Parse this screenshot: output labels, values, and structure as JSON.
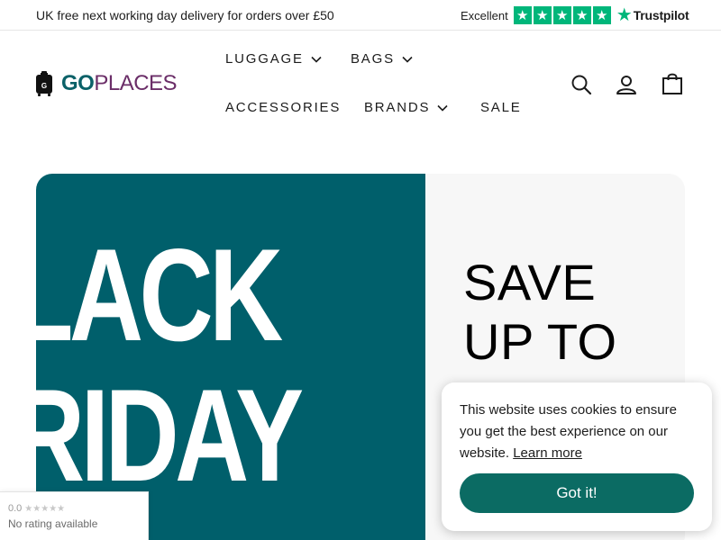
{
  "topbar": {
    "promo": "UK free next working day delivery for orders over £50",
    "trustpilot": {
      "label": "Excellent",
      "stars": 5,
      "brand": "Trustpilot"
    }
  },
  "header": {
    "logo": {
      "part1": "GO",
      "part2": "PLACES",
      "colors": {
        "go": "#0b6168",
        "places": "#6b2e68"
      }
    },
    "nav": [
      {
        "label": "LUGGAGE",
        "has_dropdown": true
      },
      {
        "label": "BAGS",
        "has_dropdown": true
      },
      {
        "label": "ACCESSORIES",
        "has_dropdown": false
      },
      {
        "label": "BRANDS",
        "has_dropdown": true
      },
      {
        "label": "SALE",
        "has_dropdown": false
      }
    ],
    "icons": [
      "search-icon",
      "account-icon",
      "cart-icon"
    ]
  },
  "hero": {
    "banner_line1": "LACK",
    "banner_line2": "RIDAY",
    "save_line1": "SAVE",
    "save_line2": "UP TO",
    "colors": {
      "banner_bg": "#005f6b",
      "panel_bg": "#f7f7f7"
    }
  },
  "cookie": {
    "message": "This website uses cookies to ensure you get the best experience on our website.",
    "learn_more": "Learn more",
    "button": "Got it!",
    "button_color": "#0b6b63"
  },
  "rating_widget": {
    "score": "0.0",
    "stars": "★★★★★",
    "text": "No rating available"
  }
}
